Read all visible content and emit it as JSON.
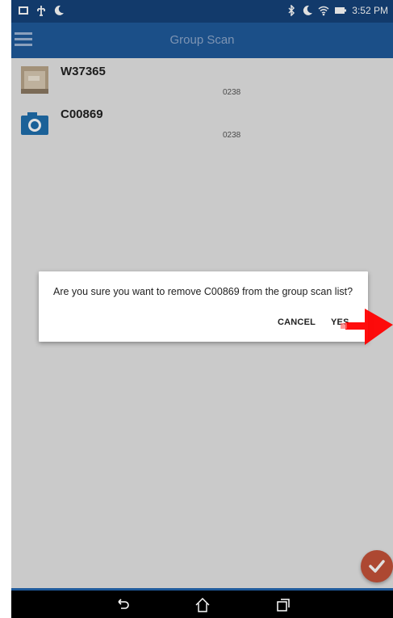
{
  "status_bar": {
    "time": "3:52 PM",
    "left_icons": [
      "image-icon",
      "usb-icon",
      "moon-icon"
    ],
    "right_icons": [
      "bluetooth-icon",
      "moon-icon",
      "wifi-icon",
      "battery-icon"
    ]
  },
  "app_bar": {
    "title": "Group Scan",
    "menu_icon": "hamburger-menu-icon"
  },
  "list": {
    "items": [
      {
        "title": "W37365",
        "subtitle": "0238",
        "thumbnail": "photo-thumbnail"
      },
      {
        "title": "C00869",
        "subtitle": "0238",
        "thumbnail": "camera-icon"
      }
    ]
  },
  "dialog": {
    "message": "Are you sure you want to remove C00869 from the group scan list?",
    "cancel_label": "CANCEL",
    "confirm_label": "YES"
  },
  "fab": {
    "icon": "checkmark-icon",
    "color": "#c5523a"
  },
  "nav_bar": {
    "icons": [
      "back-icon",
      "home-icon",
      "recent-apps-icon"
    ]
  },
  "colors": {
    "status_bar": "#15427a",
    "app_bar": "#1f5a9b",
    "background": "#e6e6e6",
    "annotation_arrow": "#ff0000"
  }
}
